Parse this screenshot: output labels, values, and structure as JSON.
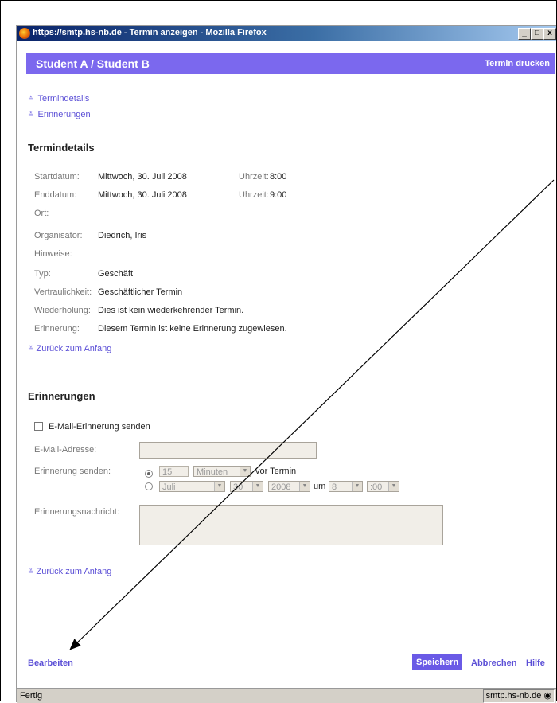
{
  "window": {
    "title": "https://smtp.hs-nb.de - Termin anzeigen - Mozilla Firefox",
    "buttons": {
      "minimize": "_",
      "maximize": "□",
      "close": "x"
    }
  },
  "header": {
    "title": "Student A / Student B",
    "print_link": "Termin drucken"
  },
  "toc": [
    "Termindetails",
    "Erinnerungen"
  ],
  "details": {
    "section_title": "Termindetails",
    "start_label": "Startdatum:",
    "start_value": "Mittwoch, 30. Juli 2008",
    "start_time_label": "Uhrzeit:",
    "start_time_value": "8:00",
    "end_label": "Enddatum:",
    "end_value": "Mittwoch, 30. Juli 2008",
    "end_time_label": "Uhrzeit:",
    "end_time_value": "9:00",
    "location_label": "Ort:",
    "location_value": "",
    "organizer_label": "Organisator:",
    "organizer_value": "Diedrich, Iris",
    "notes_label": "Hinweise:",
    "notes_value": "",
    "type_label": "Typ:",
    "type_value": "Geschäft",
    "privacy_label": "Vertraulichkeit:",
    "privacy_value": "Geschäftlicher Termin",
    "recurrence_label": "Wiederholung:",
    "recurrence_value": "Dies ist kein wiederkehrender Termin.",
    "reminder_label": "Erinnerung:",
    "reminder_value": "Diesem Termin ist keine Erinnerung zugewiesen.",
    "back_link": "Zurück zum Anfang"
  },
  "reminders": {
    "section_title": "Erinnerungen",
    "email_checkbox_label": "E-Mail-Erinnerung senden",
    "email_label": "E-Mail-Adresse:",
    "email_value": "",
    "send_label": "Erinnerung senden:",
    "offset_value": "15",
    "unit_value": "Minuten",
    "before_text": "vor Termin",
    "month_value": "Juli",
    "day_value": "30",
    "year_value": "2008",
    "at_text": "um",
    "hour_value": "8",
    "minute_value": ":00",
    "message_label": "Erinnerungsnachricht:",
    "message_value": "",
    "back_link": "Zurück zum Anfang"
  },
  "footer": {
    "edit_link": "Bearbeiten",
    "save_button": "Speichern",
    "cancel_link": "Abbrechen",
    "help_link": "Hilfe"
  },
  "statusbar": {
    "status": "Fertig",
    "host": "smtp.hs-nb.de"
  },
  "colors": {
    "accent": "#7b68ee",
    "link": "#5b4fd6",
    "titlebar": "#0a246a"
  }
}
